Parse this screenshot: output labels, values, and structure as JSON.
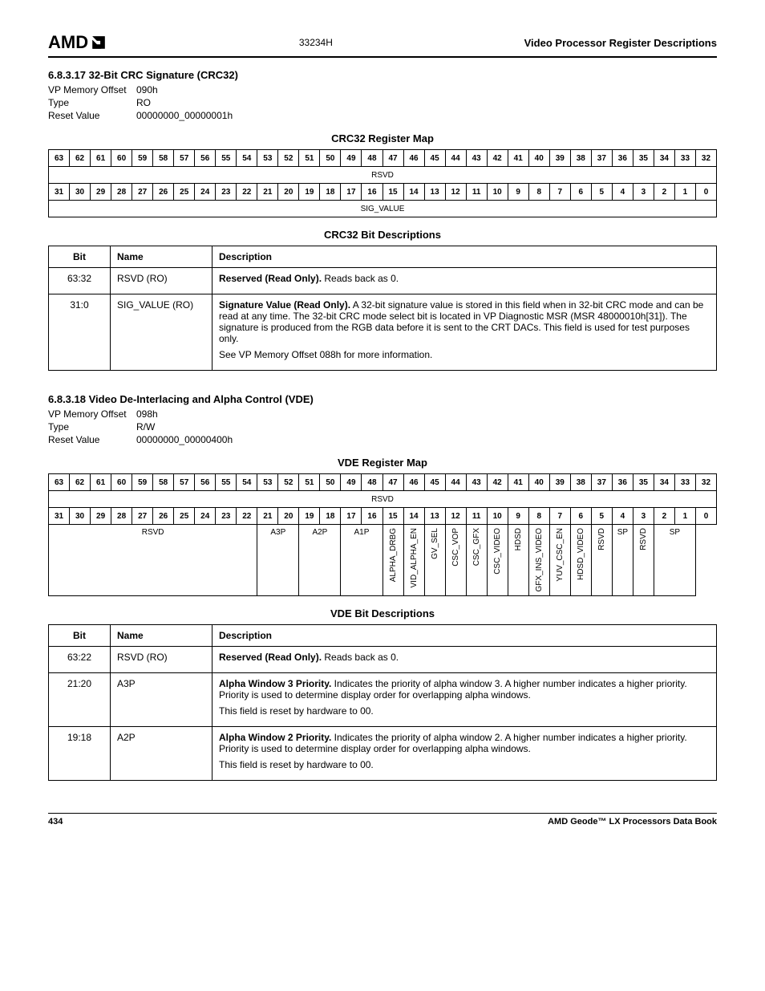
{
  "header": {
    "logo_text": "AMD",
    "doc_id": "33234H",
    "rhs_title": "Video Processor Register Descriptions"
  },
  "sec1": {
    "numtitle": "6.8.3.17   32-Bit CRC Signature (CRC32)",
    "m1_l": "VP Memory Offset",
    "m1_v": "090h",
    "m2_l": "Type",
    "m2_v": "RO",
    "m3_l": "Reset Value",
    "m3_v": "00000000_00000001h",
    "map_caption": "CRC32 Register Map",
    "bits_hi": [
      "63",
      "62",
      "61",
      "60",
      "59",
      "58",
      "57",
      "56",
      "55",
      "54",
      "53",
      "52",
      "51",
      "50",
      "49",
      "48",
      "47",
      "46",
      "45",
      "44",
      "43",
      "42",
      "41",
      "40",
      "39",
      "38",
      "37",
      "36",
      "35",
      "34",
      "33",
      "32"
    ],
    "bits_lo": [
      "31",
      "30",
      "29",
      "28",
      "27",
      "26",
      "25",
      "24",
      "23",
      "22",
      "21",
      "20",
      "19",
      "18",
      "17",
      "16",
      "15",
      "14",
      "13",
      "12",
      "11",
      "10",
      "9",
      "8",
      "7",
      "6",
      "5",
      "4",
      "3",
      "2",
      "1",
      "0"
    ],
    "field_hi": "RSVD",
    "field_lo": "SIG_VALUE",
    "desc_caption": "CRC32 Bit Descriptions",
    "desc_head": [
      "Bit",
      "Name",
      "Description"
    ],
    "rows": [
      {
        "bit": "63:32",
        "name": "RSVD (RO)",
        "d1": "Reserved (Read Only).",
        "d1b": " Reads back as 0."
      },
      {
        "bit": "31:0",
        "name": "SIG_VALUE (RO)",
        "d1": "Signature Value (Read Only).",
        "d1b": " A 32-bit signature value is stored in this field when in 32-bit CRC mode and can be read at any time. The 32-bit CRC mode select bit is located in VP Diagnostic MSR (MSR 48000010h[31]). The signature is produced from the RGB data before it is sent to the CRT DACs. This field is used for test purposes only.",
        "d2": "See VP Memory Offset 088h for more information."
      }
    ]
  },
  "sec2": {
    "numtitle": "6.8.3.18   Video De-Interlacing and Alpha Control (VDE)",
    "m1_l": "VP Memory Offset",
    "m1_v": "098h",
    "m2_l": "Type",
    "m2_v": "R/W",
    "m3_l": "Reset Value",
    "m3_v": "00000000_00000400h",
    "map_caption": "VDE Register Map",
    "bits_hi": [
      "63",
      "62",
      "61",
      "60",
      "59",
      "58",
      "57",
      "56",
      "55",
      "54",
      "53",
      "52",
      "51",
      "50",
      "49",
      "48",
      "47",
      "46",
      "45",
      "44",
      "43",
      "42",
      "41",
      "40",
      "39",
      "38",
      "37",
      "36",
      "35",
      "34",
      "33",
      "32"
    ],
    "bits_lo": [
      "31",
      "30",
      "29",
      "28",
      "27",
      "26",
      "25",
      "24",
      "23",
      "22",
      "21",
      "20",
      "19",
      "18",
      "17",
      "16",
      "15",
      "14",
      "13",
      "12",
      "11",
      "10",
      "9",
      "8",
      "7",
      "6",
      "5",
      "4",
      "3",
      "2",
      "1",
      "0"
    ],
    "field_hi": "RSVD",
    "lofields": [
      {
        "span": 10,
        "label": "RSVD",
        "vert": false
      },
      {
        "span": 2,
        "label": "A3P",
        "vert": false
      },
      {
        "span": 2,
        "label": "A2P",
        "vert": false
      },
      {
        "span": 2,
        "label": "A1P",
        "vert": false
      },
      {
        "span": 1,
        "label": "ALPHA_DRBG",
        "vert": true
      },
      {
        "span": 1,
        "label": "VID_ALPHA_EN",
        "vert": true
      },
      {
        "span": 1,
        "label": "GV_SEL",
        "vert": true
      },
      {
        "span": 1,
        "label": "CSC_VOP",
        "vert": true
      },
      {
        "span": 1,
        "label": "CSC_GFX",
        "vert": true
      },
      {
        "span": 1,
        "label": "CSC_VIDEO",
        "vert": true
      },
      {
        "span": 1,
        "label": "HDSD",
        "vert": true
      },
      {
        "span": 1,
        "label": "GFX_INS_VIDEO",
        "vert": true
      },
      {
        "span": 1,
        "label": "YUV_CSC_EN",
        "vert": true
      },
      {
        "span": 1,
        "label": "HDSD_VIDEO",
        "vert": true
      },
      {
        "span": 1,
        "label": "RSVD",
        "vert": true
      },
      {
        "span": 1,
        "label": "SP",
        "vert": false
      },
      {
        "span": 1,
        "label": "RSVD",
        "vert": true
      },
      {
        "span": 2,
        "label": "SP",
        "vert": false
      }
    ],
    "desc_caption": "VDE Bit Descriptions",
    "desc_head": [
      "Bit",
      "Name",
      "Description"
    ],
    "rows": [
      {
        "bit": "63:22",
        "name": "RSVD (RO)",
        "d1": "Reserved (Read Only).",
        "d1b": " Reads back as 0."
      },
      {
        "bit": "21:20",
        "name": "A3P",
        "d1": "Alpha Window 3 Priority.",
        "d1b": " Indicates the priority of alpha window 3. A higher number indicates a higher priority. Priority is used to determine display order for overlapping alpha windows.",
        "d2": "This field is reset by hardware to 00."
      },
      {
        "bit": "19:18",
        "name": "A2P",
        "d1": "Alpha Window 2 Priority.",
        "d1b": " Indicates the priority of alpha window 2. A higher number indicates a higher priority. Priority is used to determine display order for overlapping alpha windows.",
        "d2": "This field is reset by hardware to 00."
      }
    ]
  },
  "footer": {
    "page": "434",
    "book": "AMD Geode™ LX Processors Data Book"
  }
}
